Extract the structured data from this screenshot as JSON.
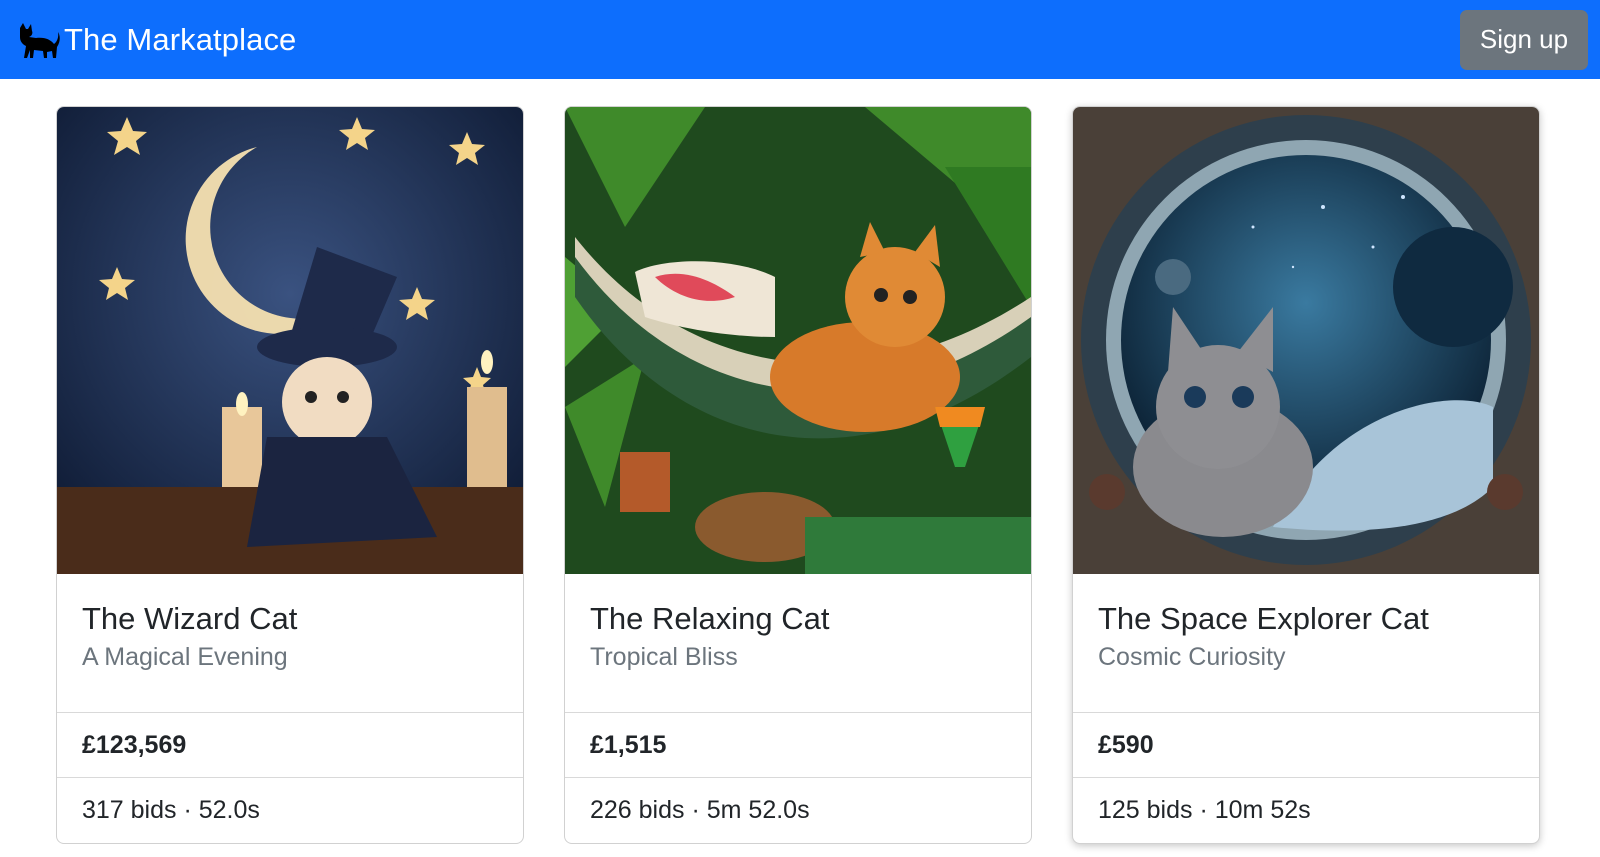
{
  "app": {
    "brand": "The Markatplace",
    "brand_icon": "cat-icon",
    "signup_label": "Sign up",
    "colors": {
      "navbar": "#0d6efd",
      "signup_button": "#6c757d",
      "subtitle": "#6c757d"
    }
  },
  "listings": [
    {
      "title": "The Wizard Cat",
      "subtitle": "A Magical Evening",
      "price": "£123,569",
      "meta": "317 bids · 52.0s"
    },
    {
      "title": "The Relaxing Cat",
      "subtitle": "Tropical Bliss",
      "price": "£1,515",
      "meta": "226 bids · 5m 52.0s"
    },
    {
      "title": "The Space Explorer Cat",
      "subtitle": "Cosmic Curiosity",
      "price": "£590",
      "meta": "125 bids · 10m 52s"
    }
  ]
}
